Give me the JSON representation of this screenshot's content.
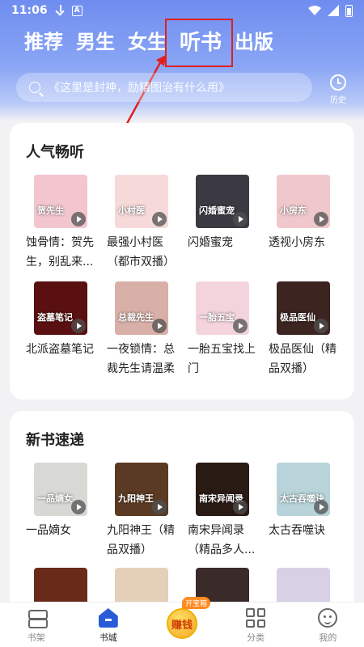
{
  "status_bar": {
    "time": "11:06"
  },
  "tabs": [
    {
      "label": "推荐",
      "active": false
    },
    {
      "label": "男生",
      "active": false
    },
    {
      "label": "女生",
      "active": false
    },
    {
      "label": "听书",
      "active": true
    },
    {
      "label": "出版",
      "active": false
    }
  ],
  "search": {
    "placeholder": "《这里是封神，励精图治有什么用》"
  },
  "history": {
    "label": "历史"
  },
  "sections": {
    "hot": {
      "title": "人气畅听",
      "books": [
        {
          "title": "蚀骨情：贺先生，别乱来...",
          "cover_text": "贺先生",
          "cover_color": "#f3c6cf"
        },
        {
          "title": "最强小村医（都市双播）",
          "cover_text": "小村医",
          "cover_color": "#f6dada"
        },
        {
          "title": "闪婚蜜宠",
          "cover_text": "闪婚蜜宠",
          "cover_color": "#3b3a42"
        },
        {
          "title": "透视小房东",
          "cover_text": "小房东",
          "cover_color": "#f0c8cc"
        },
        {
          "title": "北派盗墓笔记",
          "cover_text": "盗墓笔记",
          "cover_color": "#5a1010"
        },
        {
          "title": "一夜锁情：总裁先生请温柔",
          "cover_text": "总裁先生",
          "cover_color": "#d9b0a8"
        },
        {
          "title": "一胎五宝找上门",
          "cover_text": "一胎五宝",
          "cover_color": "#f4d4dc"
        },
        {
          "title": "极品医仙（精品双播）",
          "cover_text": "极品医仙",
          "cover_color": "#3c2420"
        }
      ]
    },
    "new": {
      "title": "新书速递",
      "books": [
        {
          "title": "一品嫡女",
          "cover_text": "一品嫡女",
          "cover_color": "#d8d8d4"
        },
        {
          "title": "九阳神王（精品双播）",
          "cover_text": "九阳神王",
          "cover_color": "#5a3a22"
        },
        {
          "title": "南宋异闻录（精品多人...",
          "cover_text": "南宋异闻录",
          "cover_color": "#2a1a14"
        },
        {
          "title": "太古吞噬诀",
          "cover_text": "太古吞噬诀",
          "cover_color": "#b8d4da"
        }
      ],
      "partial_covers": [
        "#6a2a1a",
        "#e4d0b8",
        "#3a2a2a",
        "#d8d0e4"
      ]
    }
  },
  "bottom_nav": {
    "shelf": "书架",
    "store": "书城",
    "earn": "赚钱",
    "earn_badge": "开宝箱",
    "category": "分类",
    "me": "我的"
  },
  "colors": {
    "header": "#6f8df0",
    "accent": "#2a5bd7",
    "annotation": "#e02020"
  }
}
